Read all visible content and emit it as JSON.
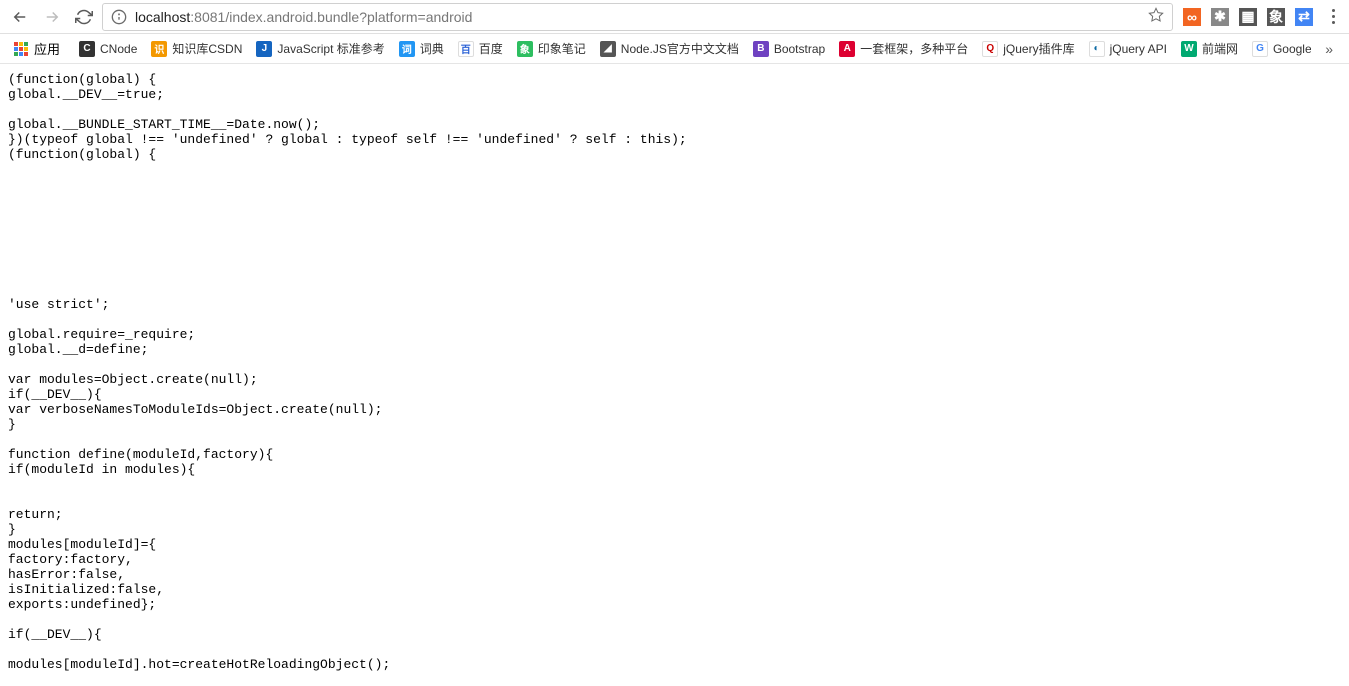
{
  "toolbar": {
    "url_host": "localhost",
    "url_port": ":8081",
    "url_path": "/index.android.bundle?platform=android"
  },
  "bookmarks": {
    "apps_label": "应用",
    "items": [
      {
        "label": "CNode",
        "bg": "#333",
        "fg": "#fff",
        "glyph": "C"
      },
      {
        "label": "知识库CSDN",
        "bg": "#f39800",
        "fg": "#fff",
        "glyph": "识"
      },
      {
        "label": "JavaScript 标准参考",
        "bg": "#1565c0",
        "fg": "#fff",
        "glyph": "J"
      },
      {
        "label": "词典",
        "bg": "#2196f3",
        "fg": "#fff",
        "glyph": "词"
      },
      {
        "label": "百度",
        "bg": "#fff",
        "fg": "#2b62d6",
        "glyph": "百"
      },
      {
        "label": "印象笔记",
        "bg": "#2dbe60",
        "fg": "#fff",
        "glyph": "象"
      },
      {
        "label": "Node.JS官方中文文档",
        "bg": "#555",
        "fg": "#fff",
        "glyph": "◢"
      },
      {
        "label": "Bootstrap",
        "bg": "#6f42c1",
        "fg": "#fff",
        "glyph": "B"
      },
      {
        "label": "一套框架，多种平台",
        "bg": "#dd0031",
        "fg": "#fff",
        "glyph": "A"
      },
      {
        "label": "jQuery插件库",
        "bg": "#fff",
        "fg": "#c90000",
        "glyph": "Q"
      },
      {
        "label": "jQuery API",
        "bg": "#fff",
        "fg": "#0a69a3",
        "glyph": "◐"
      },
      {
        "label": "前端网",
        "bg": "#00a971",
        "fg": "#fff",
        "glyph": "W"
      },
      {
        "label": "Google",
        "bg": "#fff",
        "fg": "#4285f4",
        "glyph": "G"
      }
    ],
    "overflow": "»"
  },
  "ext_icons": [
    {
      "name": "ext-1",
      "bg": "#f26522",
      "fg": "#fff",
      "glyph": "∞"
    },
    {
      "name": "ext-2",
      "bg": "#888",
      "fg": "#fff",
      "glyph": "✱"
    },
    {
      "name": "ext-3",
      "bg": "#555",
      "fg": "#fff",
      "glyph": "▦"
    },
    {
      "name": "ext-evernote",
      "bg": "#565656",
      "fg": "#fff",
      "glyph": "象"
    },
    {
      "name": "ext-translate",
      "bg": "#4285f4",
      "fg": "#fff",
      "glyph": "⇄"
    }
  ],
  "code": "(function(global) {\nglobal.__DEV__=true;\n\nglobal.__BUNDLE_START_TIME__=Date.now();\n})(typeof global !== 'undefined' ? global : typeof self !== 'undefined' ? self : this);\n(function(global) {\n\n\n\n\n\n\n\n\n\n'use strict';\n\nglobal.require=_require;\nglobal.__d=define;\n\nvar modules=Object.create(null);\nif(__DEV__){\nvar verboseNamesToModuleIds=Object.create(null);\n}\n\nfunction define(moduleId,factory){\nif(moduleId in modules){\n\n\nreturn;\n}\nmodules[moduleId]={\nfactory:factory,\nhasError:false,\nisInitialized:false,\nexports:undefined};\n\nif(__DEV__){\n\nmodules[moduleId].hot=createHotReloadingObject();\n"
}
